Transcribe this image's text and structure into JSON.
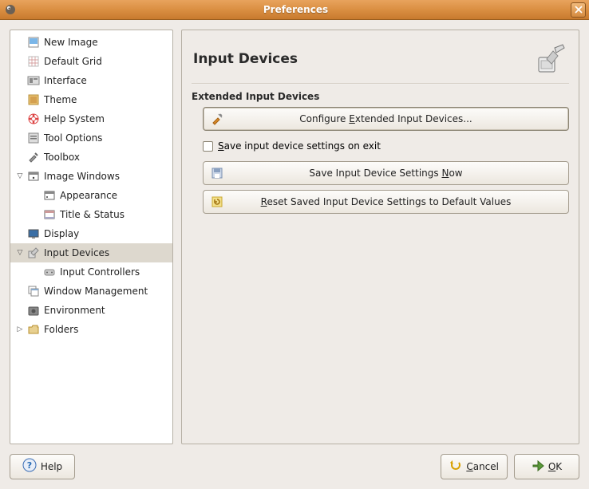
{
  "window": {
    "title": "Preferences"
  },
  "sidebar": {
    "items": [
      {
        "label": "New Image"
      },
      {
        "label": "Default Grid"
      },
      {
        "label": "Interface"
      },
      {
        "label": "Theme"
      },
      {
        "label": "Help System"
      },
      {
        "label": "Tool Options"
      },
      {
        "label": "Toolbox"
      },
      {
        "label": "Image Windows"
      },
      {
        "label": "Appearance"
      },
      {
        "label": "Title & Status"
      },
      {
        "label": "Display"
      },
      {
        "label": "Input Devices"
      },
      {
        "label": "Input Controllers"
      },
      {
        "label": "Window Management"
      },
      {
        "label": "Environment"
      },
      {
        "label": "Folders"
      }
    ]
  },
  "panel": {
    "title": "Input Devices",
    "section_title": "Extended Input Devices",
    "configure_pre": "Configure ",
    "configure_ul": "E",
    "configure_post": "xtended Input Devices...",
    "checkbox_ul": "S",
    "checkbox_post": "ave input device settings on exit",
    "save_pre": "Save Input Device Settings ",
    "save_ul": "N",
    "save_post": "ow",
    "reset_ul": "R",
    "reset_post": "eset Saved Input Device Settings to Default Values"
  },
  "buttons": {
    "help": "Help",
    "cancel_ul": "C",
    "cancel_post": "ancel",
    "ok_ul": "O",
    "ok_post": "K"
  }
}
